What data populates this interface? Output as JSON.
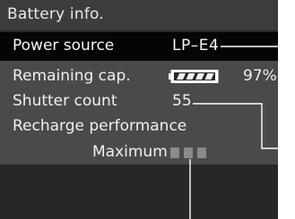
{
  "screen": {
    "title": "Battery info.",
    "power_source": {
      "label": "Power source",
      "value": "LP–E4"
    },
    "remaining_capacity": {
      "label": "Remaining cap.",
      "value": "97%",
      "level_percent": 97
    },
    "shutter_count": {
      "label": "Shutter count",
      "value": "55"
    },
    "recharge_performance": {
      "label": "Recharge performance",
      "value": "Maximum",
      "bars_filled": 3,
      "bars_total": 3
    }
  },
  "colors": {
    "lcd_background": "#272727",
    "title_bar": "#3c3c3c",
    "selected_row": "#050505",
    "info_panel": "#4a4a4a",
    "text": "#f0f0f0",
    "callout_line": "#ffffff"
  }
}
